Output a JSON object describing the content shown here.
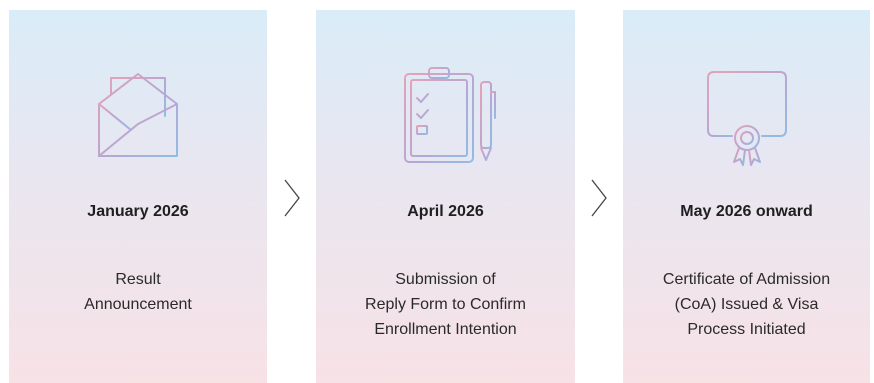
{
  "steps": [
    {
      "date": "January 2026",
      "lines": [
        "Result",
        "Announcement"
      ],
      "icon": "envelope-letter-icon"
    },
    {
      "date": "April 2026",
      "lines": [
        "Submission of",
        "Reply Form to Confirm",
        "Enrollment Intention"
      ],
      "icon": "clipboard-checklist-icon"
    },
    {
      "date": "May 2026 onward",
      "lines": [
        "Certificate of Admission",
        "(CoA) Issued & Visa",
        "Process Initiated"
      ],
      "icon": "certificate-ribbon-icon"
    }
  ],
  "colors": {
    "icon_blue": "#8fbde4",
    "icon_pink": "#e3a3b7",
    "card_top": "#d9ecf8",
    "card_bottom": "#f7e2e6"
  }
}
